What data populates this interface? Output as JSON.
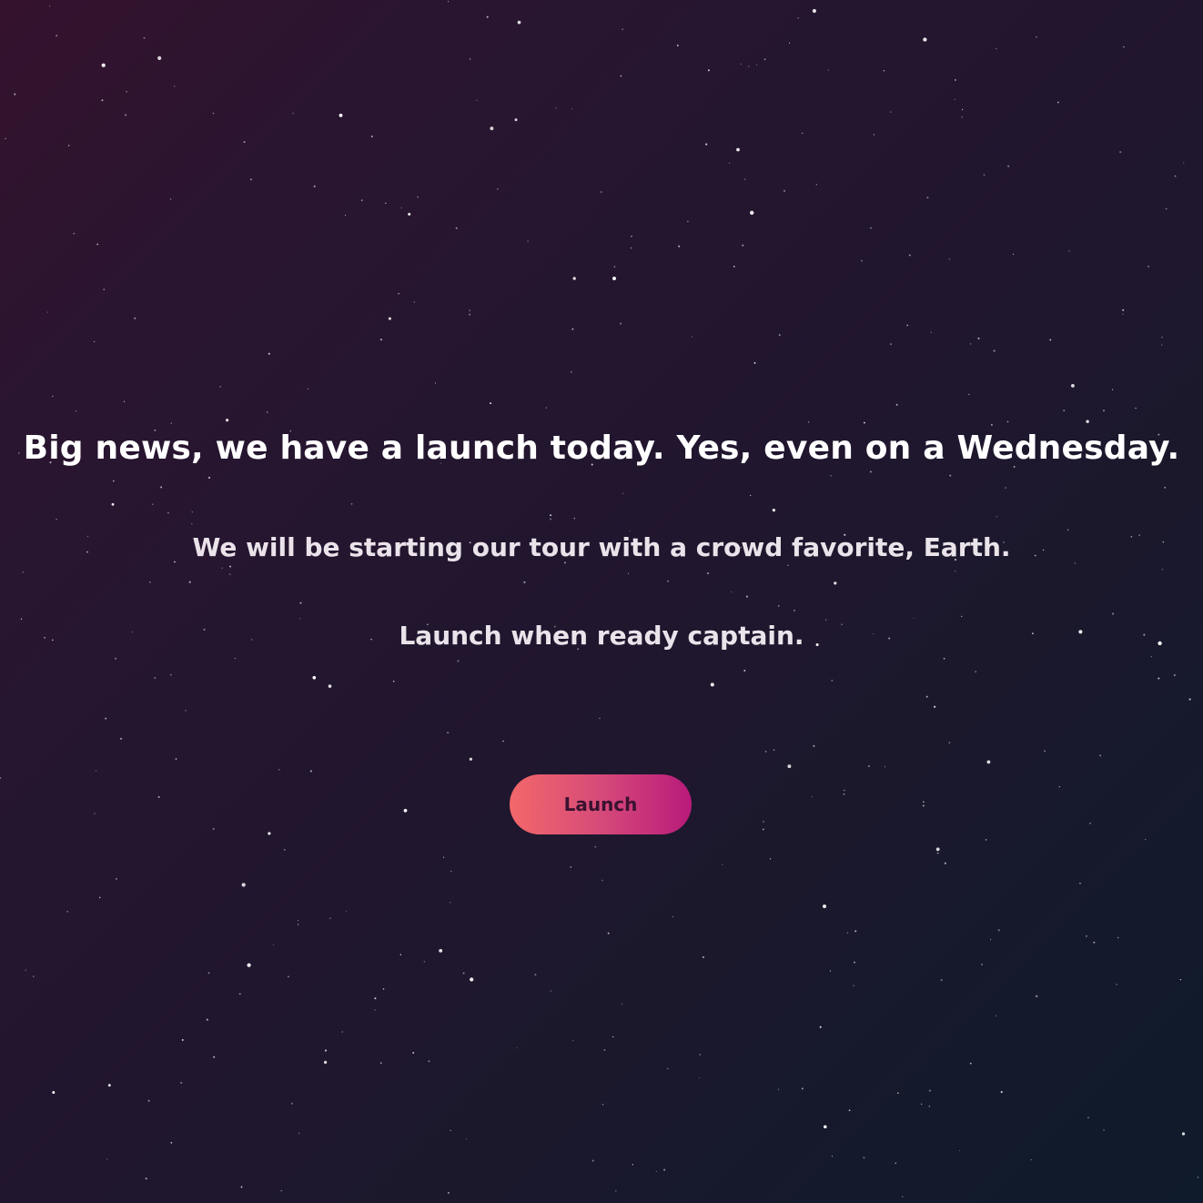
{
  "background": {
    "gradient_colors": [
      "#34122d",
      "#22162f",
      "#1b182c",
      "#0f1a2a"
    ],
    "star_color": "#ffffff"
  },
  "hero": {
    "headline": "Big news, we have a launch today. Yes, even on a Wednesday.",
    "subline": "We will be starting our tour with a crowd favorite, Earth.",
    "cta_text": "Launch when ready captain."
  },
  "launch_button": {
    "label": "Launch",
    "gradient_colors": [
      "#f2686a",
      "#b81a7a"
    ]
  }
}
